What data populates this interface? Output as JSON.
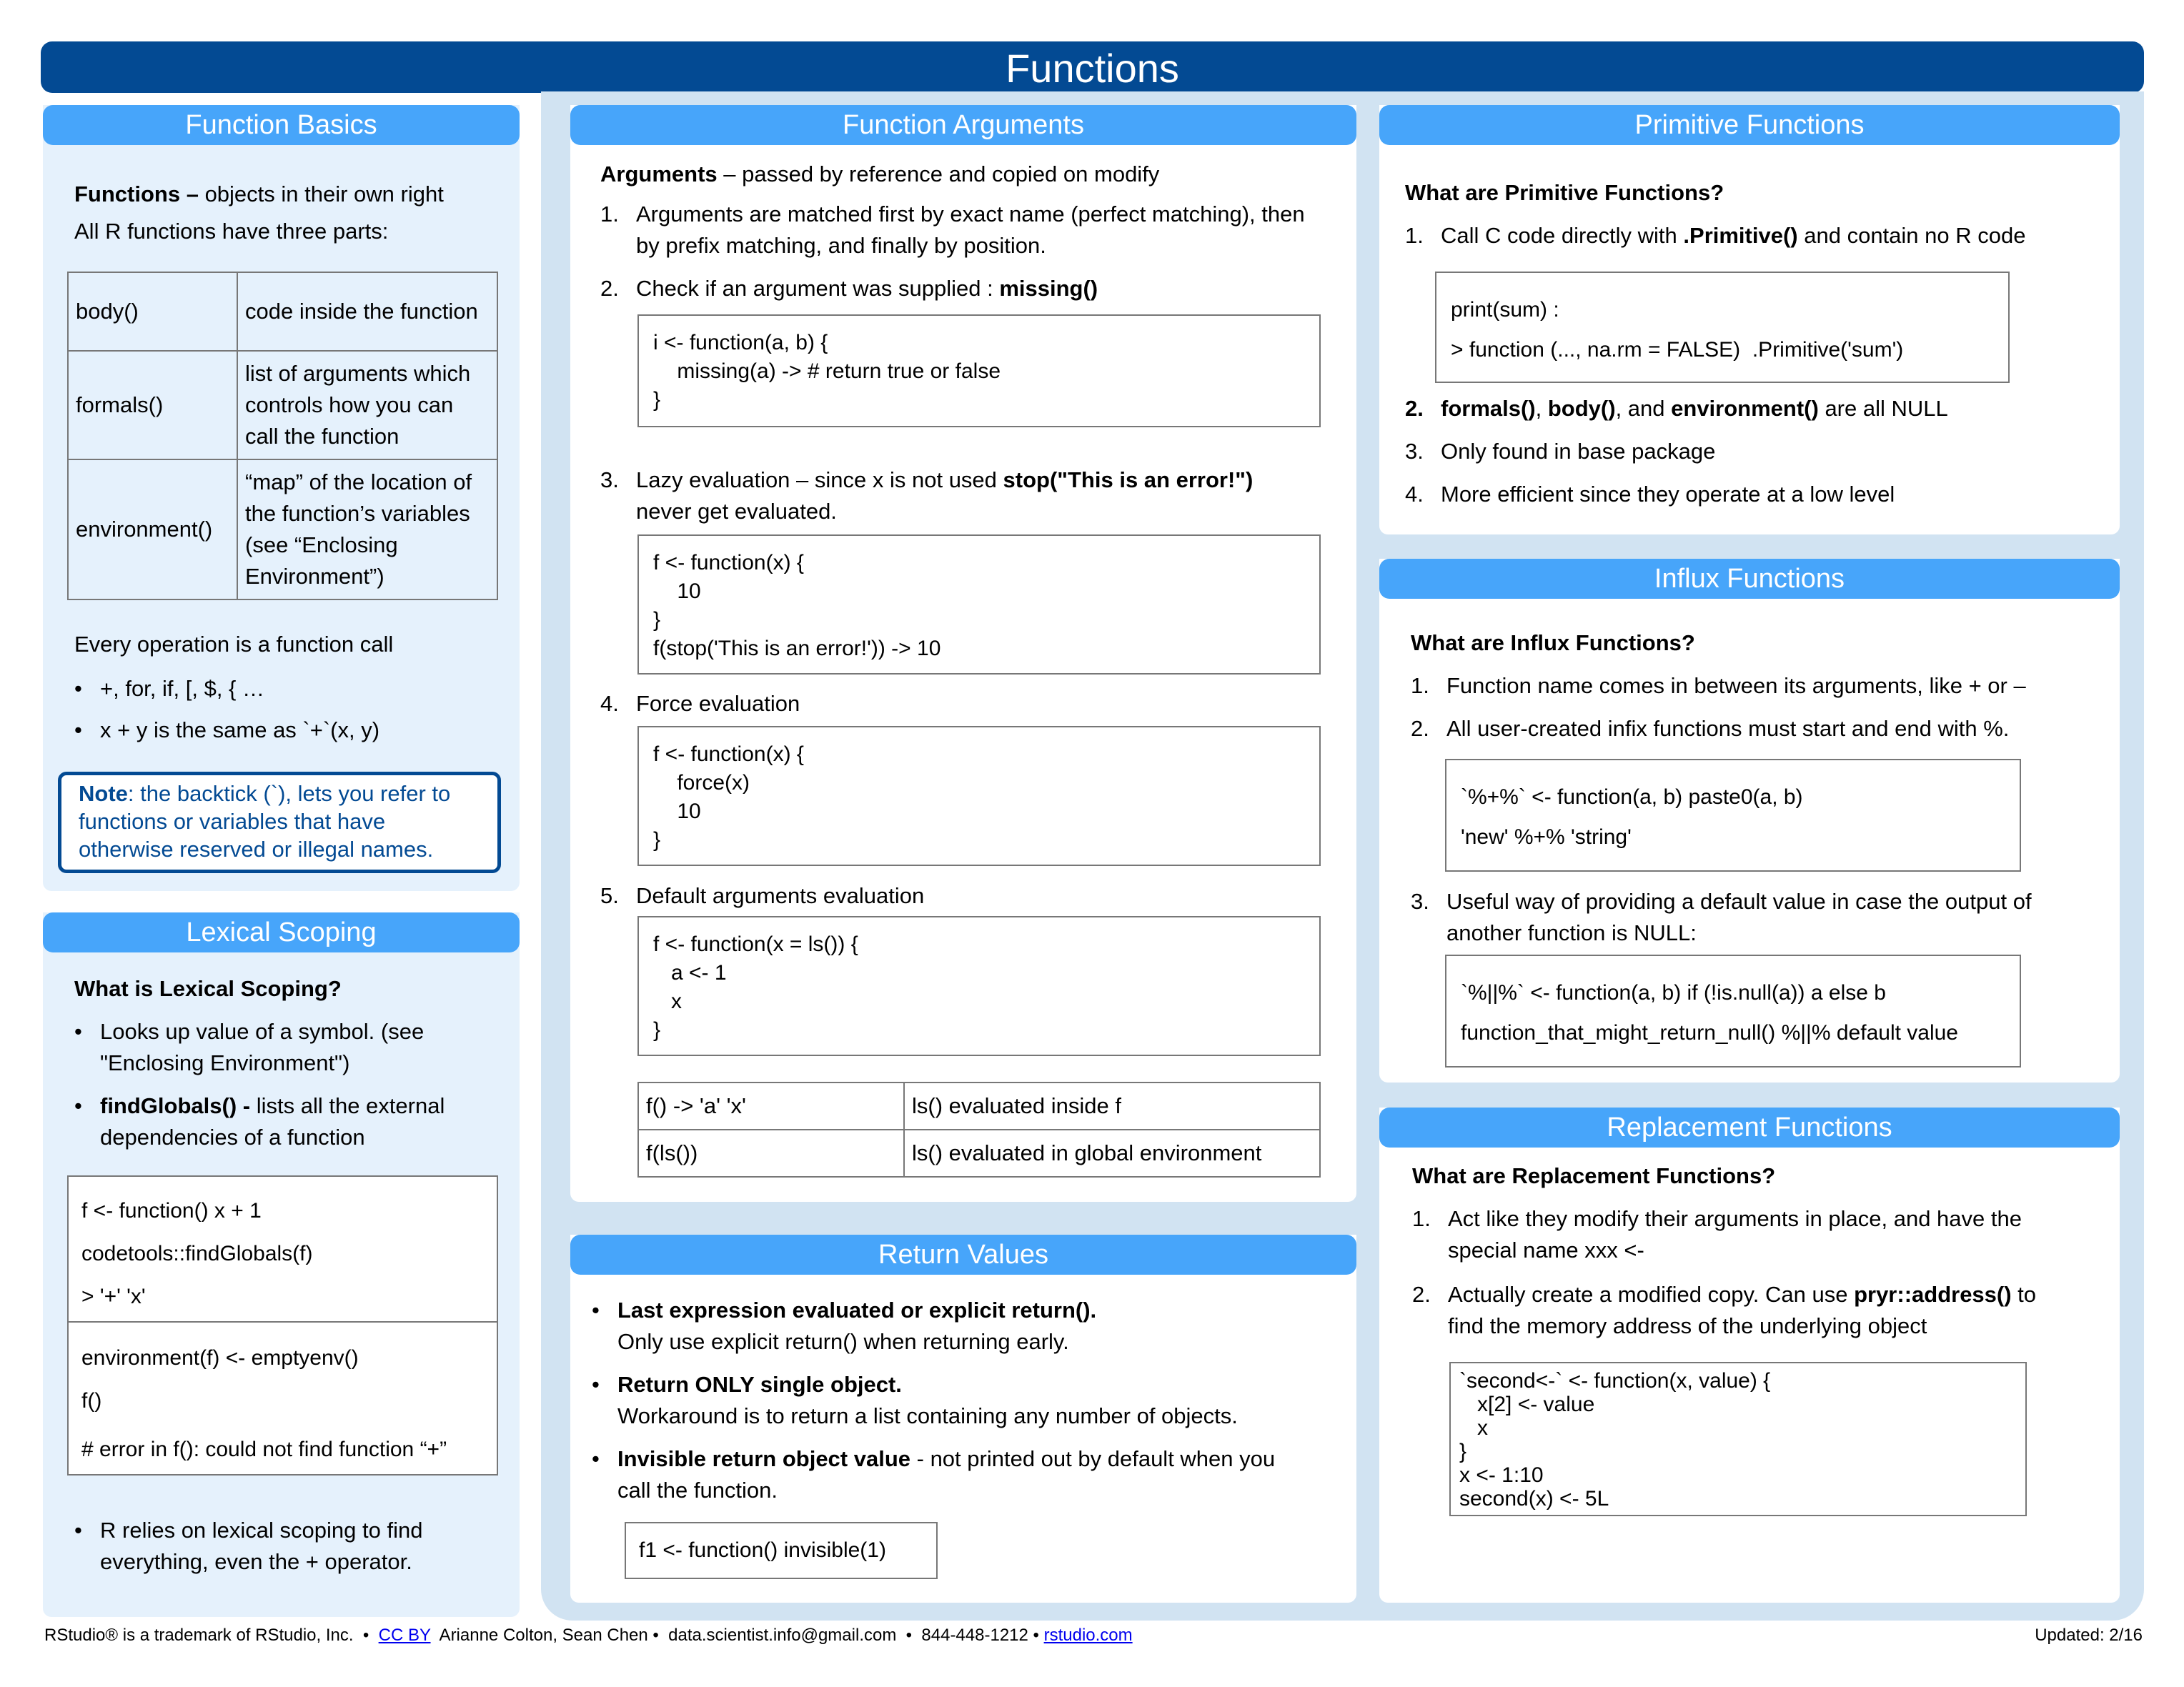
{
  "title": "Functions",
  "colors": {
    "title_bar": "#034A93",
    "section_header": "#47A5FA",
    "panel_bg": "#D1E3F2",
    "left_panel_bg": "#E5F1FC",
    "note_text": "#034A93",
    "link": "#0000EE"
  },
  "function_basics": {
    "header": "Function Basics",
    "intro_bold": "Functions –",
    "intro_rest": " objects in their own right",
    "line2": "All R functions have three parts:",
    "parts_table": [
      {
        "name": "body()",
        "desc": [
          "code inside the function"
        ]
      },
      {
        "name": "formals()",
        "desc": [
          "list of arguments which",
          "controls how you can",
          "call the function"
        ]
      },
      {
        "name": "environment()",
        "desc": [
          "“map” of the location of",
          "the function’s variables",
          "(see “Enclosing",
          "Environment”)"
        ]
      }
    ],
    "every_op": "Every operation is a function call",
    "bullets": [
      "+, for, if, [, $, { …",
      "x + y is the same as `+`(x, y)"
    ],
    "note_bold": "Note",
    "note_lines": [
      ": the backtick (`), lets you refer to",
      "functions or variables that have",
      "otherwise reserved or illegal names."
    ]
  },
  "lexical_scoping": {
    "header": "Lexical Scoping",
    "question": "What is Lexical Scoping?",
    "bullet1": [
      "Looks up value of a symbol. (see",
      "\"Enclosing Environment\")"
    ],
    "bullet2_bold": "findGlobals() -",
    "bullet2_rest": [
      " lists all the external",
      "dependencies of a function"
    ],
    "code_top": [
      "f <- function() x + 1",
      "codetools::findGlobals(f)",
      "> '+' 'x'"
    ],
    "code_bottom": [
      "environment(f) <- emptyenv()",
      "f()",
      "# error in f(): could not find function “+”"
    ],
    "closing_bullet": [
      "R relies on lexical scoping to find",
      "everything, even the + operator."
    ]
  },
  "function_arguments": {
    "header": "Function Arguments",
    "intro_bold": "Arguments",
    "intro_rest": " – passed by reference and copied on modify",
    "items": [
      {
        "num": "1.",
        "lines": [
          "Arguments are matched first by exact name (perfect matching), then",
          "by prefix matching, and finally by position."
        ]
      },
      {
        "num": "2.",
        "text": "Check if an argument was supplied :  ",
        "bold": "missing()"
      },
      {
        "num": "3.",
        "text": "Lazy evaluation – since x is not used ",
        "bold": "stop(\"This is an error!\")",
        "line2": "never get evaluated."
      },
      {
        "num": "4.",
        "text": "Force evaluation"
      },
      {
        "num": "5.",
        "text": "Default arguments evaluation"
      }
    ],
    "code_missing": [
      "i <- function(a, b) {",
      "    missing(a) -> # return true or false",
      "}"
    ],
    "code_lazy": [
      "f <- function(x) {",
      "    10",
      "}",
      "f(stop('This is an error!')) -> 10"
    ],
    "code_force": [
      "f <- function(x) {",
      "    force(x)",
      "    10",
      "}"
    ],
    "code_default": [
      "f <- function(x = ls()) {",
      "   a <- 1",
      "   x",
      "}"
    ],
    "eval_table": [
      {
        "call": "f() -> 'a' 'x'",
        "desc": "ls() evaluated inside f"
      },
      {
        "call": "f(ls())",
        "desc": "ls() evaluated in global environment"
      }
    ]
  },
  "return_values": {
    "header": "Return Values",
    "bullets": [
      {
        "bold": "Last expression evaluated or explicit return().",
        "rest": "",
        "line2": "Only use explicit return() when returning early."
      },
      {
        "bold": "Return ONLY single object.",
        "rest": "",
        "line2": "Workaround is to return a list containing any number of objects."
      },
      {
        "bold": "Invisible return object value",
        "rest": " - not printed out by default  when you",
        "line2": "call the function."
      }
    ],
    "code": "f1 <- function() invisible(1)"
  },
  "primitive_functions": {
    "header": "Primitive Functions",
    "question": "What are Primitive Functions?",
    "item1": {
      "num": "1.",
      "pre": "Call C code directly with ",
      "bold": ".Primitive()",
      "post": " and contain no R code"
    },
    "code": [
      "print(sum) :",
      "> function (..., na.rm = FALSE)  .Primitive('sum')"
    ],
    "item2": {
      "num": "2.",
      "b1": "formals()",
      "t1": ", ",
      "b2": "body()",
      "t2": ", and ",
      "b3": "environment()",
      "t3": " are all NULL"
    },
    "item3": {
      "num": "3.",
      "text": "Only found in base package"
    },
    "item4": {
      "num": "4.",
      "text": "More efficient since they operate at a low level"
    }
  },
  "influx_functions": {
    "header": "Influx Functions",
    "question": "What are Influx Functions?",
    "items": [
      {
        "num": "1.",
        "text": "Function name comes in between its arguments, like + or –"
      },
      {
        "num": "2.",
        "text": "All user-created infix functions must start and end with %."
      },
      {
        "num": "3.",
        "lines": [
          "Useful way of providing a default value in case the output of",
          "another function is NULL:"
        ]
      }
    ],
    "code1": [
      "`%+%` <- function(a, b) paste0(a, b)",
      "'new' %+% 'string'"
    ],
    "code2": [
      "`%||%` <- function(a, b) if (!is.null(a)) a else b",
      "function_that_might_return_null() %||% default value"
    ]
  },
  "replacement_functions": {
    "header": "Replacement Functions",
    "question": "What are Replacement Functions?",
    "item1": {
      "num": "1.",
      "lines": [
        "Act like they modify their arguments in place, and have the",
        "special name xxx <-"
      ]
    },
    "item2": {
      "num": "2.",
      "pre": "Actually create a modified copy. Can use ",
      "bold": "pryr::address()",
      "post": " to",
      "line2": "find the memory address of the underlying object"
    },
    "code": [
      "`second<-` <- function(x, value) {",
      "   x[2] <- value",
      "   x",
      "}",
      "x <- 1:10",
      "second(x) <- 5L"
    ]
  },
  "footer": {
    "trademark": "RStudio® is a trademark of RStudio, Inc.  •  ",
    "license_link": "CC BY",
    "authors": "  Arianne Colton, Sean Chen •  data.scientist.info@gmail.com  •  844-448-1212 • ",
    "site_link": "rstudio.com",
    "updated": "Updated: 2/16"
  }
}
